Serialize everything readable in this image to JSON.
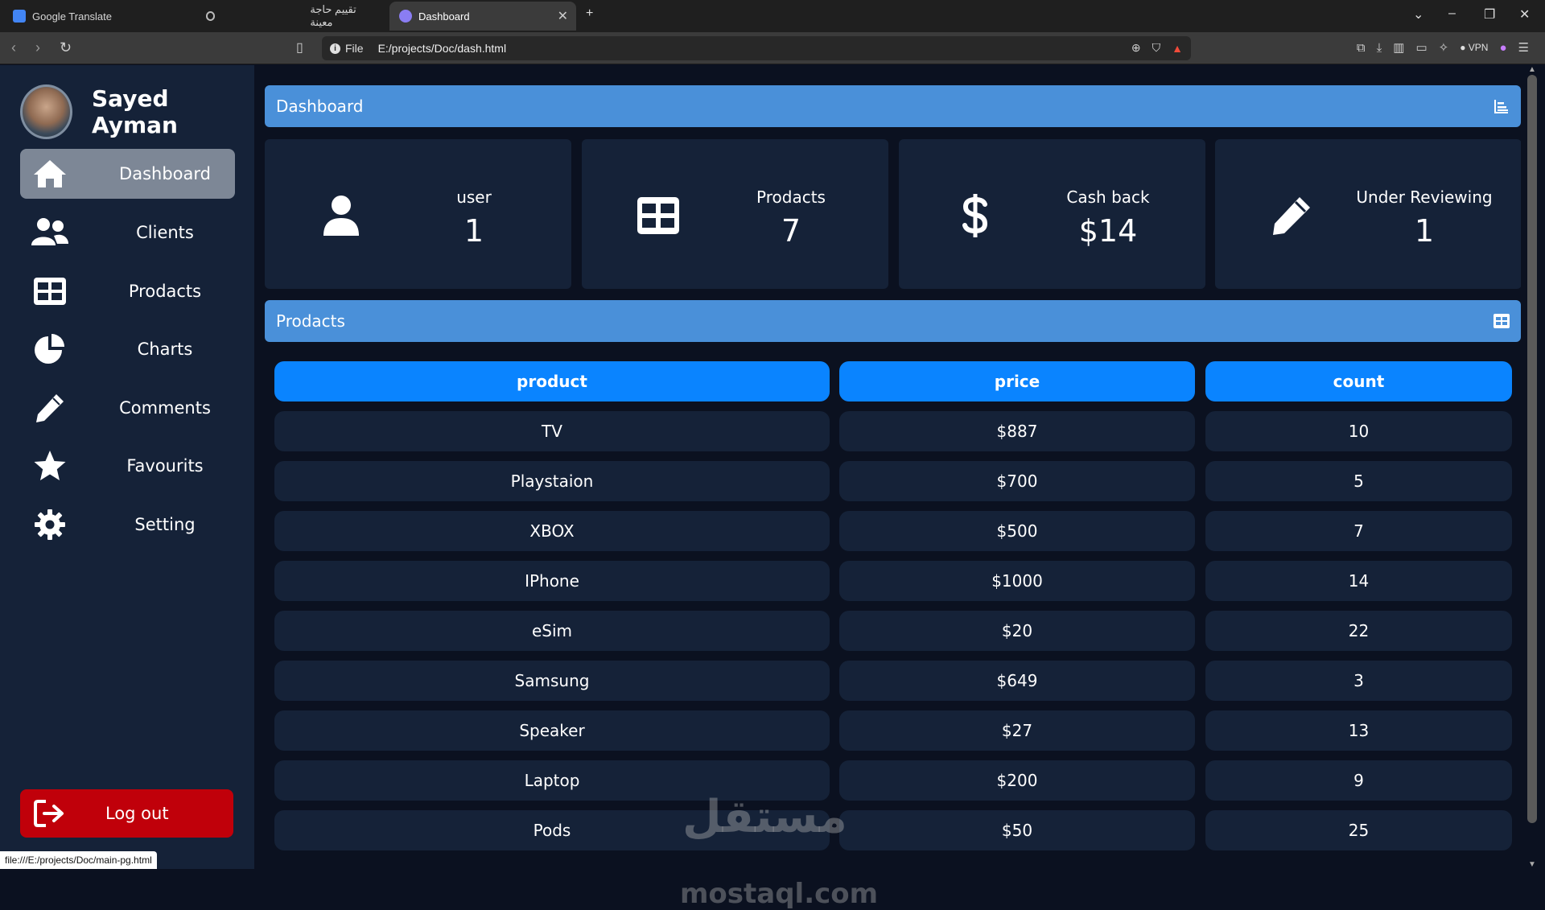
{
  "browser": {
    "tabs": [
      {
        "title": "Google Translate",
        "active": false
      },
      {
        "title": "تقييم حاجة معينة",
        "active": false
      },
      {
        "title": "Dashboard",
        "active": true
      }
    ],
    "file_label": "File",
    "url": "E:/projects/Doc/dash.html",
    "vpn_label": "VPN",
    "status_url": "file:///E:/projects/Doc/main-pg.html"
  },
  "profile": {
    "name": "Sayed Ayman"
  },
  "sidebar": {
    "items": [
      {
        "label": "Dashboard",
        "icon": "home-icon",
        "active": true
      },
      {
        "label": "Clients",
        "icon": "users-icon",
        "active": false
      },
      {
        "label": "Prodacts",
        "icon": "table-icon",
        "active": false
      },
      {
        "label": "Charts",
        "icon": "pie-chart-icon",
        "active": false
      },
      {
        "label": "Comments",
        "icon": "pencil-icon",
        "active": false
      },
      {
        "label": "Favourits",
        "icon": "star-icon",
        "active": false
      },
      {
        "label": "Setting",
        "icon": "gear-icon",
        "active": false
      }
    ],
    "logout_label": "Log out"
  },
  "dashboard": {
    "title": "Dashboard",
    "cards": [
      {
        "label": "user",
        "value": "1",
        "icon": "user-icon"
      },
      {
        "label": "Prodacts",
        "value": "7",
        "icon": "table-icon"
      },
      {
        "label": "Cash back",
        "value": "$14",
        "icon": "dollar-icon"
      },
      {
        "label": "Under Reviewing",
        "value": "1",
        "icon": "pencil-icon"
      }
    ]
  },
  "products": {
    "title": "Prodacts",
    "columns": [
      "product",
      "price",
      "count"
    ],
    "rows": [
      [
        "TV",
        "$887",
        "10"
      ],
      [
        "Playstaion",
        "$700",
        "5"
      ],
      [
        "XBOX",
        "$500",
        "7"
      ],
      [
        "IPhone",
        "$1000",
        "14"
      ],
      [
        "eSim",
        "$20",
        "22"
      ],
      [
        "Samsung",
        "$649",
        "3"
      ],
      [
        "Speaker",
        "$27",
        "13"
      ],
      [
        "Laptop",
        "$200",
        "9"
      ],
      [
        "Pods",
        "$50",
        "25"
      ]
    ]
  },
  "watermark": "mostaql.com",
  "colors": {
    "page_bg": "#0b1120",
    "panel_bg": "#152238",
    "section_bar": "#4a90d9",
    "table_head": "#0a84ff",
    "active_nav": "#7d8796",
    "logout": "#c0000a"
  }
}
